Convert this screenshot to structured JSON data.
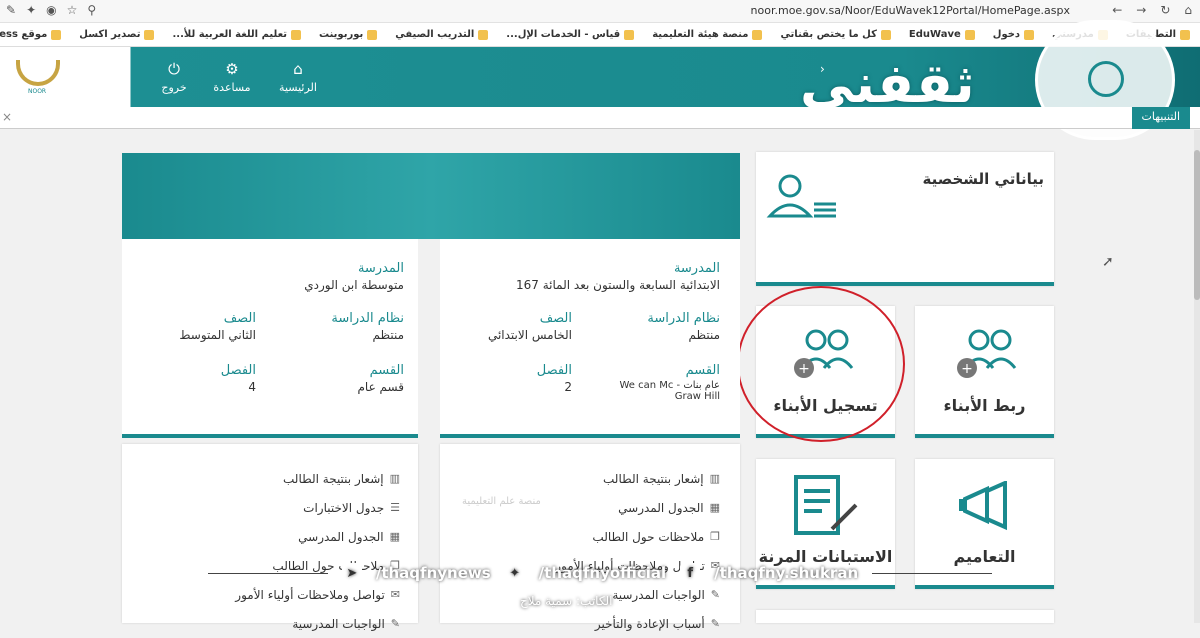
{
  "browser": {
    "url": "noor.moe.gov.sa/Noor/EduWavek12Portal/HomePage.aspx"
  },
  "bookmarks": [
    "التطبيقات",
    "مدرستي",
    "دخول",
    "EduWave",
    "كل ما يختص بقناتي",
    "منصة هيئة التعليمية",
    "قياس - الخدمات الإل...",
    "التدريب الصيفي",
    "بوربوينت",
    "تعليم اللغة العربية للأ...",
    "تصدير اكسل",
    "موقع AR.aliexpress..."
  ],
  "header": {
    "nav": [
      {
        "label": "الرئيسية",
        "icon": "home-icon"
      },
      {
        "label": "مساعدة",
        "icon": "gear-icon"
      },
      {
        "label": "خروج",
        "icon": "power-icon"
      }
    ],
    "logo_text": "NOOR",
    "brand_overlay": "ثقفني"
  },
  "notifications": {
    "tab": "التنبيهات"
  },
  "personal": {
    "title": "بياناتي الشخصية"
  },
  "tiles": {
    "link_children": "ربط الأبناء",
    "register_children": "تسجيل الأبناء",
    "circulars": "التعاميم",
    "surveys": "الاستبانات المرنة"
  },
  "student1": {
    "school_label": "المدرسة",
    "school": "الابتدائية السابعة والستون بعد المائة 167",
    "system_label": "نظام الدراسة",
    "system": "منتظم",
    "grade_label": "الصف",
    "grade": "الخامس الابتدائي",
    "section_label": "القسم",
    "section": "عام بنات - We can Mc Graw Hill",
    "class_label": "الفصل",
    "class": "2"
  },
  "student2": {
    "school_label": "المدرسة",
    "school": "متوسطة ابن الوردي",
    "system_label": "نظام الدراسة",
    "system": "منتظم",
    "grade_label": "الصف",
    "grade": "الثاني المتوسط",
    "section_label": "القسم",
    "section": "قسم عام",
    "class_label": "الفصل",
    "class": "4"
  },
  "student1_links": [
    "إشعار بنتيجة الطالب",
    "الجدول المدرسي",
    "ملاحظات حول الطالب",
    "تواصل وملاحظات أولياء الأمور",
    "الواجبات المدرسية",
    "أسباب الإعادة والتأخير"
  ],
  "student2_links": [
    "إشعار بنتيجة الطالب",
    "جدول الاختبارات",
    "الجدول المدرسي",
    "ملاحظات حول الطالب",
    "تواصل وملاحظات أولياء الأمور",
    "الواجبات المدرسية"
  ],
  "watermark": "منصة علم التعليمية",
  "social": {
    "facebook": "/thaqfny.shukran",
    "twitter": "/thaqfnyofficial",
    "telegram": "/thaqfnynews"
  },
  "author": "الكاتب: سمية ملاح"
}
